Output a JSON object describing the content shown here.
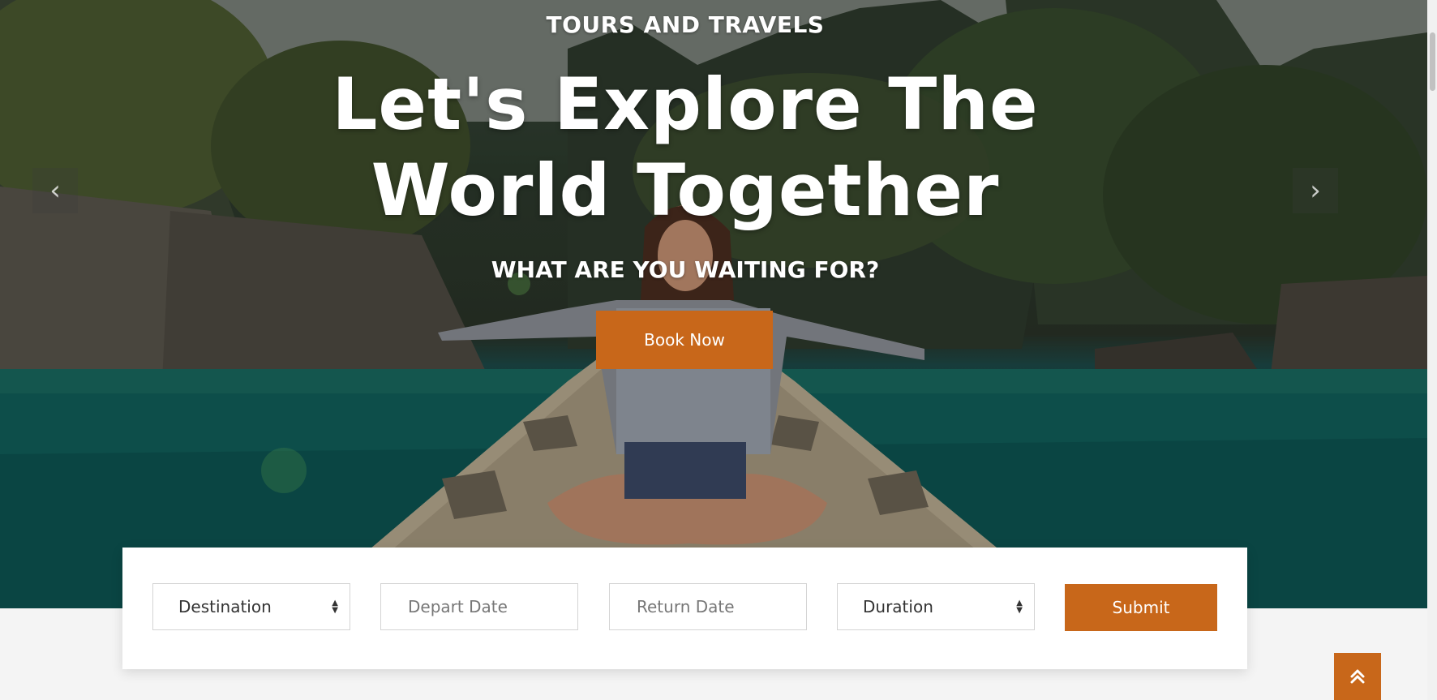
{
  "hero": {
    "eyebrow": "TOURS AND TRAVELS",
    "headline": "Let's Explore The World Together",
    "subhead": "WHAT ARE YOU WAITING FOR?",
    "cta_label": "Book Now",
    "prev_icon": "‹",
    "next_icon": "›"
  },
  "search_form": {
    "destination": {
      "selected": "Destination"
    },
    "depart_date": {
      "placeholder": "Depart Date"
    },
    "return_date": {
      "placeholder": "Return Date"
    },
    "duration": {
      "selected": "Duration"
    },
    "submit_label": "Submit"
  },
  "back_to_top_icon": "double-chevron-up",
  "colors": {
    "accent": "#c8671a",
    "white": "#ffffff"
  }
}
